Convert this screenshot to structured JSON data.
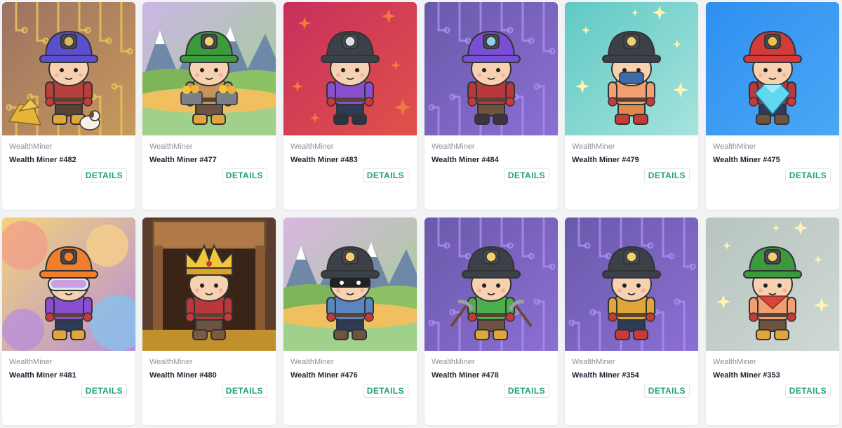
{
  "colors": {
    "page_bg": "#f2f3f5",
    "card_bg": "#ffffff",
    "details_text": "#20a36b",
    "collection_text": "#8a8f98",
    "title_text": "#1d2330"
  },
  "cards": [
    {
      "collection": "WealthMiner",
      "title": "Wealth Miner #482",
      "details_label": "DETAILS",
      "bg": "#9c7263",
      "bg2": "#c89a5a",
      "helmet": "#5b4fd0",
      "lamp": "#d9b66a",
      "shirt": "#b6403c",
      "pants": "#5a4334",
      "boots": "#e0a63a",
      "deco": "circuit-gold",
      "item": "gold-nuggets-dog"
    },
    {
      "collection": "WealthMiner",
      "title": "Wealth Miner #477",
      "details_label": "DETAILS",
      "bg": "#cbb6e6",
      "bg2": "#9fd08c",
      "helmet": "#3a9a3c",
      "lamp": "#f0d070",
      "shirt": "#c5935b",
      "pants": "#6e5340",
      "boots": "#e0a63a",
      "deco": "mountains",
      "item": "gold-carts"
    },
    {
      "collection": "WealthMiner",
      "title": "Wealth Miner #483",
      "details_label": "DETAILS",
      "bg": "#c72f5c",
      "bg2": "#e0524a",
      "helmet": "#3c4049",
      "lamp": "#dce3ea",
      "shirt": "#8a4fd0",
      "pants": "#2d3a58",
      "boots": "#2f3340",
      "deco": "stars",
      "item": "none"
    },
    {
      "collection": "WealthMiner",
      "title": "Wealth Miner #484",
      "details_label": "DETAILS",
      "bg": "#6a5aaa",
      "bg2": "#8b6fd3",
      "helmet": "#7a4fd8",
      "lamp": "#8fd0e8",
      "shirt": "#b8383c",
      "pants": "#6e5340",
      "boots": "#3a3540",
      "deco": "circuit-purple",
      "item": "none"
    },
    {
      "collection": "WealthMiner",
      "title": "Wealth Miner #479",
      "details_label": "DETAILS",
      "bg": "#5fc9c4",
      "bg2": "#a7e3dd",
      "helmet": "#3c4049",
      "lamp": "#f0d070",
      "shirt": "#f0a070",
      "pants": "#e08a4a",
      "boots": "#c63a3a",
      "deco": "stars-light",
      "item": "mask"
    },
    {
      "collection": "WealthMiner",
      "title": "Wealth Miner #475",
      "details_label": "DETAILS",
      "bg": "#2f8ff0",
      "bg2": "#4aa8f5",
      "helmet": "#d33a3a",
      "lamp": "#f0c050",
      "shirt": "#b8383c",
      "pants": "#2d3a58",
      "boots": "#6e5340",
      "deco": "plain",
      "item": "diamond"
    },
    {
      "collection": "WealthMiner",
      "title": "Wealth Miner #481",
      "details_label": "DETAILS",
      "bg": "#f3d37a",
      "bg2": "#b88fd8",
      "helmet": "#f07e2a",
      "lamp": "#f07e2a",
      "shirt": "#8a4fd0",
      "pants": "#2d3a58",
      "boots": "#e0a63a",
      "deco": "paint",
      "item": "goggles"
    },
    {
      "collection": "WealthMiner",
      "title": "Wealth Miner #480",
      "details_label": "DETAILS",
      "bg": "#6b4a35",
      "bg2": "#a9763f",
      "helmet": "#f2c53a",
      "lamp": "#f2c53a",
      "shirt": "#b8383c",
      "pants": "#6e5340",
      "boots": "#7a5a40",
      "deco": "mine",
      "item": "crown"
    },
    {
      "collection": "WealthMiner",
      "title": "Wealth Miner #476",
      "details_label": "DETAILS",
      "bg": "#d9b6e3",
      "bg2": "#9fd08c",
      "helmet": "#3c4049",
      "lamp": "#f0d070",
      "shirt": "#5a86c0",
      "pants": "#2d3a58",
      "boots": "#6e5340",
      "deco": "mountains",
      "item": "bandit-mask"
    },
    {
      "collection": "WealthMiner",
      "title": "Wealth Miner #478",
      "details_label": "DETAILS",
      "bg": "#6a5aaa",
      "bg2": "#8b6fd3",
      "helmet": "#3c4049",
      "lamp": "#f0d070",
      "shirt": "#4bb04b",
      "pants": "#6e5340",
      "boots": "#e0a63a",
      "deco": "circuit-purple",
      "item": "pickaxes"
    },
    {
      "collection": "WealthMiner",
      "title": "Wealth Miner #354",
      "details_label": "DETAILS",
      "bg": "#6a5aaa",
      "bg2": "#8b6fd3",
      "helmet": "#3c4049",
      "lamp": "#f0d070",
      "shirt": "#e0a63a",
      "pants": "#2d3a58",
      "boots": "#c63a3a",
      "deco": "circuit-purple",
      "item": "none"
    },
    {
      "collection": "WealthMiner",
      "title": "Wealth Miner #353",
      "details_label": "DETAILS",
      "bg": "#b7c4bf",
      "bg2": "#cfd8d4",
      "helmet": "#3a9a3c",
      "lamp": "#f0d070",
      "shirt": "#f0a070",
      "pants": "#6e5340",
      "boots": "#e0a63a",
      "deco": "stars-light",
      "item": "bandana"
    }
  ]
}
